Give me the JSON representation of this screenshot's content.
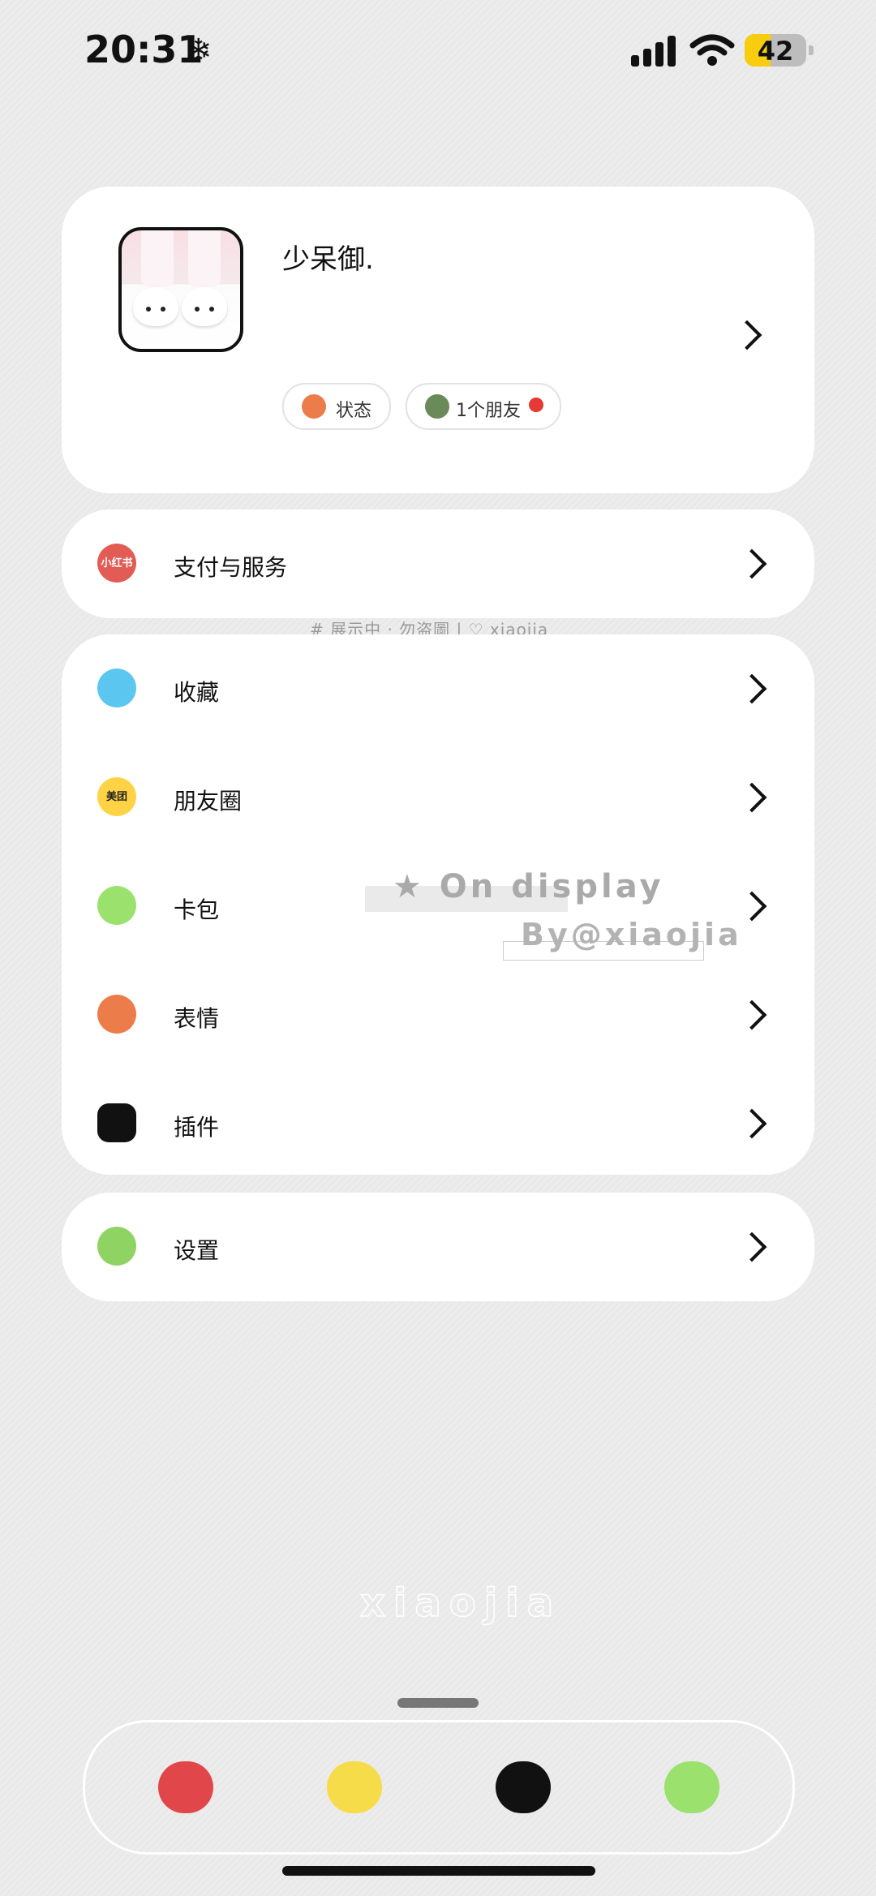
{
  "status": {
    "time": "20:31",
    "snow_icon": "❄",
    "battery": "42",
    "battery_level": 0.42,
    "signal_icon": "cellular-signal-icon",
    "wifi_icon": "wifi-icon"
  },
  "profile": {
    "nickname": "少呆御.",
    "chips": [
      {
        "label": "状态",
        "icon": "status-icon"
      },
      {
        "label": "1个朋友",
        "icon": "friend-avatar-icon"
      }
    ]
  },
  "groups": {
    "pay": [
      {
        "label": "支付与服务",
        "icon": "xiaohongshu-icon",
        "icon_text": "小红书",
        "color": "#e25b55"
      }
    ],
    "main": [
      {
        "label": "收藏",
        "icon": "weather-icon",
        "icon_text": "",
        "color": "#5bc7f0"
      },
      {
        "label": "朋友圈",
        "icon": "meituan-icon",
        "icon_text": "美团",
        "color": "#ffd345"
      },
      {
        "label": "卡包",
        "icon": "wechat-icon",
        "icon_text": "",
        "color": "#9be16d"
      },
      {
        "label": "表情",
        "icon": "sticker-icon",
        "icon_text": "",
        "color": "#ec7d4a"
      },
      {
        "label": "插件",
        "icon": "smile-icon",
        "icon_text": "",
        "color": "#111111"
      }
    ],
    "settings": [
      {
        "label": "设置",
        "icon": "messages-icon",
        "icon_text": "",
        "color": "#8fd463"
      }
    ]
  },
  "watermarks": {
    "line1": "# 展示中 · 勿盗圖 | ♡ xiaojia",
    "line2": "★ On display",
    "line3": "By@xiaojia",
    "big": "xiaojia"
  },
  "dock": [
    {
      "name": "netease-music-icon",
      "color": "#e1474a"
    },
    {
      "name": "mail-icon",
      "color": "#f7dc4a"
    },
    {
      "name": "tiktok-icon",
      "color": "#111111"
    },
    {
      "name": "wechat-dock-icon",
      "color": "#9be16d"
    }
  ]
}
